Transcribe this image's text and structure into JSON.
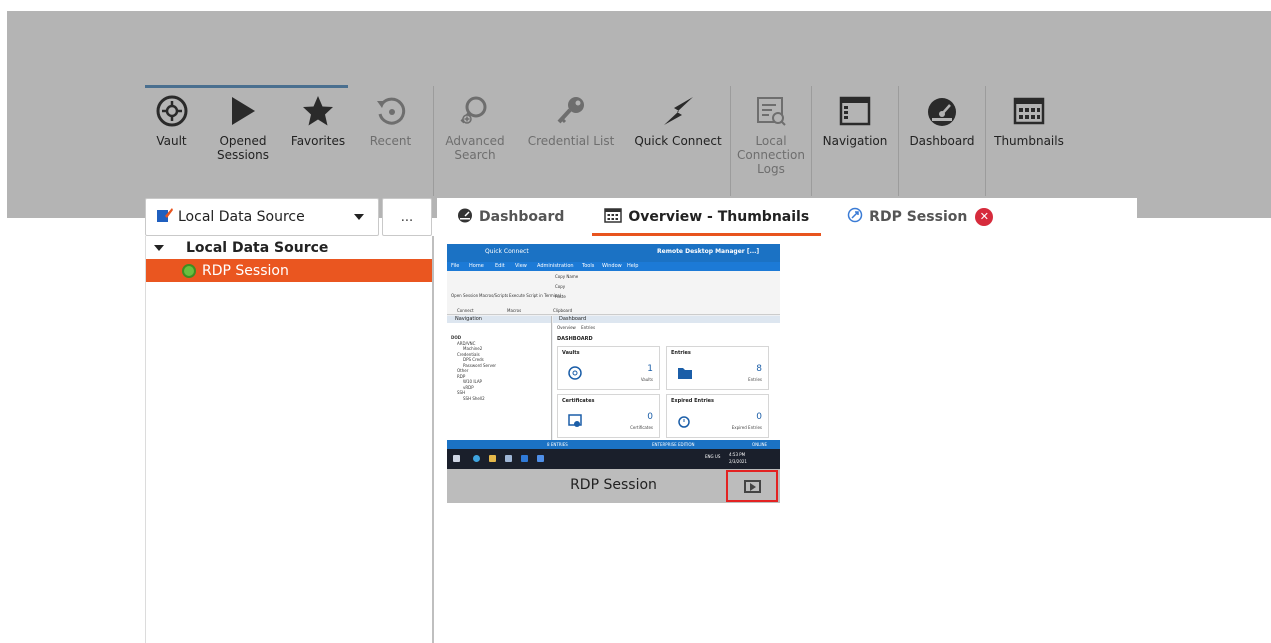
{
  "ribbon": {
    "items": [
      {
        "name": "vault-button",
        "icon": "vault-icon",
        "label": "Vault",
        "enabled": true
      },
      {
        "name": "opened-sessions-button",
        "icon": "play-icon",
        "label": "Opened\nSessions",
        "enabled": true
      },
      {
        "name": "favorites-button",
        "icon": "star-icon",
        "label": "Favorites",
        "enabled": true
      },
      {
        "name": "recent-button",
        "icon": "history-icon",
        "label": "Recent",
        "enabled": false
      },
      {
        "name": "advanced-search-button",
        "icon": "search-plus-icon",
        "label": "Advanced\nSearch",
        "enabled": false
      },
      {
        "name": "credential-list-button",
        "icon": "key-icon",
        "label": "Credential List",
        "enabled": false
      },
      {
        "name": "quick-connect-button",
        "icon": "lightning-icon",
        "label": "Quick Connect",
        "enabled": true
      },
      {
        "name": "local-connection-logs-button",
        "icon": "logs-icon",
        "label": "Local\nConnection\nLogs",
        "enabled": false
      },
      {
        "name": "navigation-button",
        "icon": "navigation-icon",
        "label": "Navigation",
        "enabled": true
      },
      {
        "name": "dashboard-button",
        "icon": "dashboard-icon",
        "label": "Dashboard",
        "enabled": true
      },
      {
        "name": "thumbnails-button",
        "icon": "thumbnails-icon",
        "label": "Thumbnails",
        "enabled": true
      }
    ]
  },
  "data_source": {
    "selected": "Local Data Source",
    "more_label": "..."
  },
  "tabs": [
    {
      "label": "Dashboard",
      "icon": "dashboard-icon",
      "active": false
    },
    {
      "label": "Overview - Thumbnails",
      "icon": "thumbnails-icon",
      "active": true
    },
    {
      "label": "RDP Session",
      "icon": "rdp-icon",
      "active": false,
      "closable": true
    }
  ],
  "tree": {
    "root": "Local Data Source",
    "children": [
      {
        "label": "RDP Session",
        "selected": true
      }
    ]
  },
  "thumbnail": {
    "label": "RDP Session",
    "screen": {
      "title_bar": "Remote Desktop Manager [...]",
      "quick_connect": "Quick Connect",
      "menu": [
        "File",
        "Home",
        "Edit",
        "View",
        "Administration",
        "Tools",
        "Window",
        "Help"
      ],
      "ribbon": [
        "Open Session",
        "Macros/Scripts",
        "Execute Script in Terminal",
        "Copy Name",
        "Copy",
        "Paste",
        "Connect",
        "Macros",
        "Clipboard"
      ],
      "navigation_title": "Navigation",
      "navigation_root": "DOD",
      "nav_items": [
        "ARD/VNC",
        "Machine2",
        "Credentials",
        "DPS Creds",
        "Password Server",
        "Other",
        "RDP",
        "W10 ILAP",
        "vRDP",
        "SSH",
        "SSH Shell2"
      ],
      "dashboard_title": "Dashboard",
      "dashboard_tabs": [
        "Overview",
        "Entries"
      ],
      "dashboard_heading": "DASHBOARD",
      "tiles": [
        {
          "title": "Vaults",
          "count": "1",
          "sub": "Vaults"
        },
        {
          "title": "Entries",
          "count": "8",
          "sub": "Entries"
        },
        {
          "title": "Certificates",
          "count": "0",
          "sub": "Certificates"
        },
        {
          "title": "Expired Entries",
          "count": "0",
          "sub": "Expired Entries"
        }
      ],
      "status_left": "8 ENTRIES",
      "status_mid": "ENTERPRISE EDITION",
      "status_right": "ONLINE",
      "taskbar_time": "4:53 PM",
      "taskbar_date": "2/3/2021",
      "taskbar_lang": "ENG US"
    }
  },
  "colors": {
    "accent": "#ea5620",
    "close": "#d62b3c",
    "ribbon_bg": "#b4b4b4",
    "highlight_border": "#e32222",
    "mini_blue": "#1b72c4"
  }
}
